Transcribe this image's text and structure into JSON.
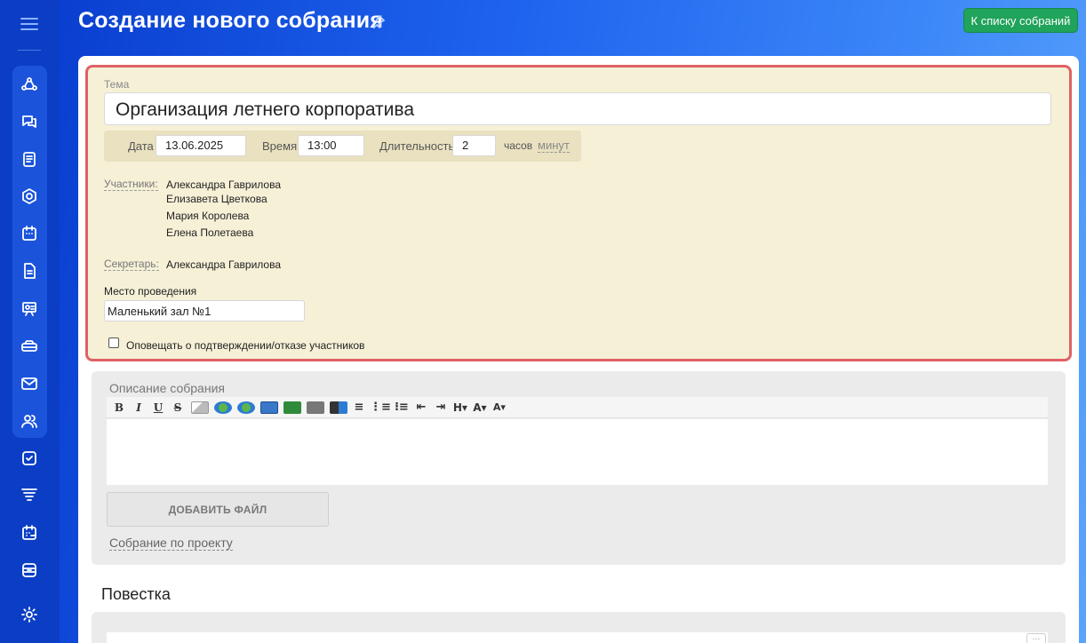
{
  "header": {
    "title": "Создание нового собрания",
    "back_button": "К списку собраний"
  },
  "form": {
    "topic_label": "Тема",
    "topic_value": "Организация летнего корпоратива",
    "date_label": "Дата",
    "date_value": "13.06.2025",
    "time_label": "Время",
    "time_value": "13:00",
    "duration_label": "Длительность",
    "duration_value": "2",
    "hours_label": "часов",
    "minutes_link": "минут",
    "participants_label": "Участники:",
    "participants": [
      "Александра Гаврилова",
      "Елизавета Цветкова",
      "Мария Королева",
      "Елена Полетаева"
    ],
    "secretary_label": "Секретарь:",
    "secretary_value": "Александра Гаврилова",
    "place_label": "Место проведения",
    "place_value": "Маленький зал №1",
    "notify_label": "Оповещать о подтверждении/отказе участников"
  },
  "description": {
    "label": "Описание собрания",
    "toolbar": [
      "B",
      "I",
      "U",
      "S",
      "H▾",
      "A▾",
      "A▾"
    ],
    "add_file_button": "ДОБАВИТЬ ФАЙЛ",
    "project_link": "Собрание по проекту"
  },
  "agenda": {
    "title": "Повестка"
  },
  "sidebar_icons": [
    "menu-icon",
    "crm-icon",
    "chat-icon",
    "document-icon",
    "hexagon-icon",
    "calendar-icon",
    "file-icon",
    "presentation-icon",
    "drive-icon",
    "mail-icon",
    "users-icon",
    "tasks-icon",
    "funnel-icon",
    "schedule-icon",
    "archive-icon",
    "settings-icon"
  ],
  "colors": {
    "accent": "#1a5ee8",
    "success": "#20a35a",
    "highlight_border": "#e06165",
    "highlight_bg": "#f6f0d7"
  }
}
